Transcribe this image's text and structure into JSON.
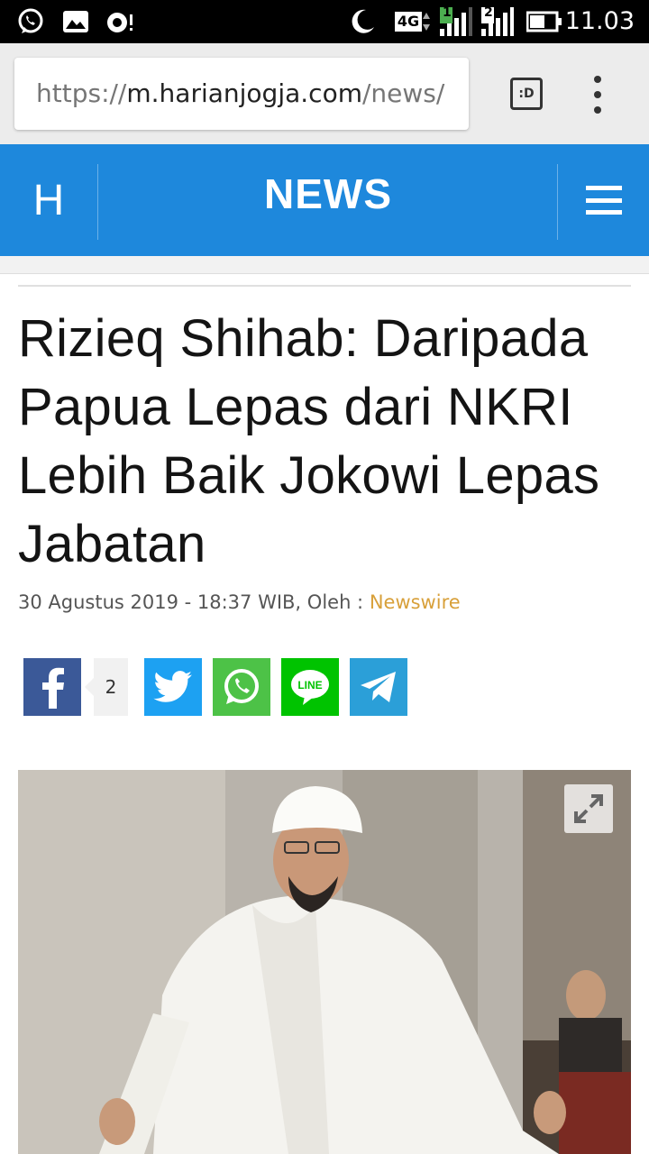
{
  "status_bar": {
    "network": "4G",
    "sim1": "1",
    "sim2": "2",
    "time": "11.03"
  },
  "browser": {
    "url_scheme": "https://",
    "url_host": "m.harianjogja.com",
    "url_path": "/news/",
    "reader_mode_label": ":D"
  },
  "site": {
    "logo": "H",
    "section": "NEWS"
  },
  "article": {
    "title": "Rizieq Shihab: Daripada Papua Lepas dari NKRI Lebih Baik Jokowi Lepas Jabatan",
    "date_line": "30 Agustus 2019 - 18:37 WIB, Oleh : ",
    "author": "Newswire"
  },
  "share": {
    "facebook_count": "2",
    "line_label": "LINE",
    "colors": {
      "facebook": "#3b5998",
      "twitter": "#1da1f2",
      "whatsapp": "#4dc247",
      "line": "#00c300",
      "telegram": "#2b9fd8"
    }
  },
  "icons": [
    "whatsapp-icon",
    "gallery-icon",
    "camera-icon",
    "moon-icon",
    "signal-icon",
    "battery-icon",
    "expand-icon"
  ],
  "colors": {
    "header_blue": "#1e88dc",
    "author_gold": "#d8a03a"
  }
}
